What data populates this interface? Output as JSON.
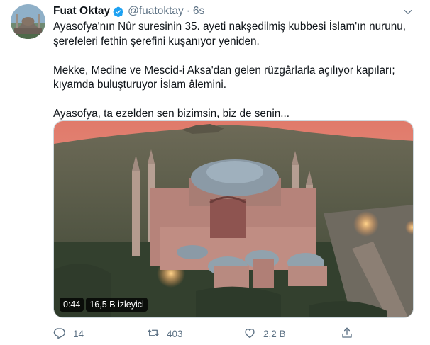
{
  "tweet": {
    "author_name": "Fuat Oktay",
    "handle": "@fuatoktay",
    "separator": "·",
    "time": "6s",
    "text_lines": [
      "Ayasofya'nın Nûr suresinin 35. ayeti nakşedilmiş kubbesi İslam'ın nurunu,",
      "şerefeleri fethin şerefini kuşanıyor yeniden.",
      "",
      "Mekke, Medine ve Mescid-i Aksa'dan gelen rüzgârlarla açılıyor kapıları;",
      "kıyamda buluşturuyor İslam âlemini.",
      "",
      "Ayasofya, ta ezelden sen bizimsin, biz de senin..."
    ]
  },
  "video": {
    "duration": "0:44",
    "views": "16,5 B izleyici"
  },
  "actions": {
    "reply_count": "14",
    "retweet_count": "403",
    "like_count": "2,2 B"
  },
  "colors": {
    "text": "#0f1419",
    "secondary": "#5b7083",
    "verified": "#1da1f2",
    "border": "#cfd9de"
  },
  "icons": [
    "verified-badge-icon",
    "chevron-down-icon",
    "reply-icon",
    "retweet-icon",
    "like-icon",
    "share-icon"
  ]
}
